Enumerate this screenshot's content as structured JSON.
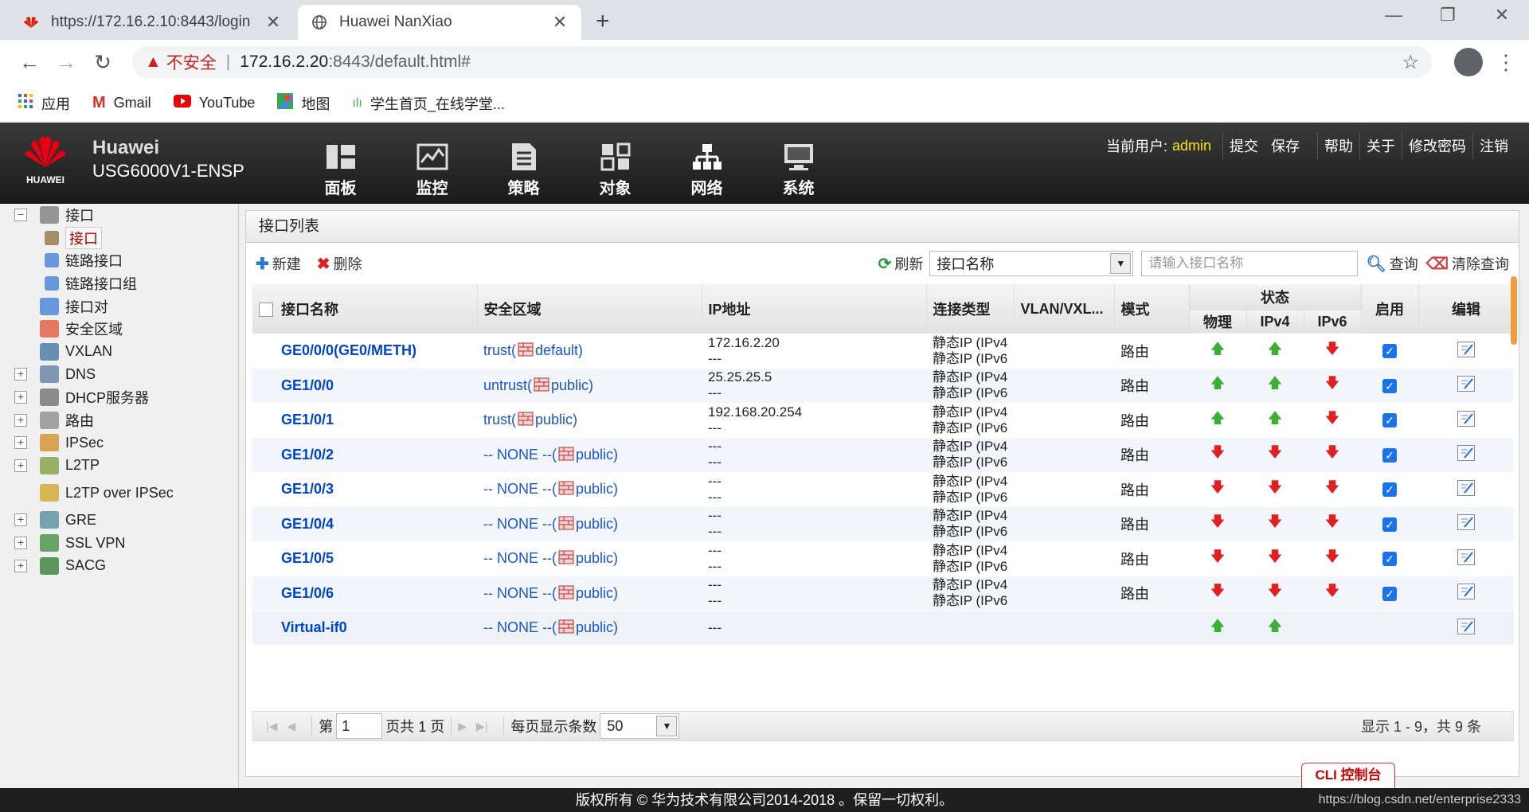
{
  "browser": {
    "tabs": [
      {
        "title": "https://172.16.2.10:8443/login",
        "active": false
      },
      {
        "title": "Huawei NanXiao",
        "active": true
      }
    ],
    "address": {
      "insecure_label": "不安全",
      "host": "172.16.2.20",
      "path": ":8443/default.html#"
    },
    "bookmarks": [
      {
        "label": "应用",
        "icon": "apps-grid-icon"
      },
      {
        "label": "Gmail",
        "icon": "gmail-icon"
      },
      {
        "label": "YouTube",
        "icon": "youtube-icon"
      },
      {
        "label": "地图",
        "icon": "maps-icon"
      },
      {
        "label": "学生首页_在线学堂...",
        "icon": "audio-wave-icon"
      }
    ]
  },
  "app": {
    "logo_text": "HUAWEI",
    "brand_line1": "Huawei",
    "brand_line2": "USG6000V1-ENSP",
    "nav": [
      {
        "label": "面板",
        "icon": "dashboard-icon"
      },
      {
        "label": "监控",
        "icon": "monitor-chart-icon"
      },
      {
        "label": "策略",
        "icon": "policy-doc-icon"
      },
      {
        "label": "对象",
        "icon": "object-icon"
      },
      {
        "label": "网络",
        "icon": "network-icon"
      },
      {
        "label": "系统",
        "icon": "system-icon"
      }
    ],
    "user_label": "当前用户:",
    "user_name": "admin",
    "links": [
      "提交",
      "保存",
      "帮助",
      "关于",
      "修改密码",
      "注销"
    ]
  },
  "sidebar": {
    "items": [
      {
        "label": "接口",
        "expand": "-",
        "indent": 0
      },
      {
        "label": "接口",
        "expand": "",
        "indent": 1,
        "selected": true
      },
      {
        "label": "链路接口",
        "expand": "",
        "indent": 1
      },
      {
        "label": "链路接口组",
        "expand": "",
        "indent": 1
      },
      {
        "label": "接口对",
        "expand": "",
        "indent": 0
      },
      {
        "label": "安全区域",
        "expand": "",
        "indent": 0
      },
      {
        "label": "VXLAN",
        "expand": "",
        "indent": 0
      },
      {
        "label": "DNS",
        "expand": "+",
        "indent": 0
      },
      {
        "label": "DHCP服务器",
        "expand": "+",
        "indent": 0
      },
      {
        "label": "路由",
        "expand": "+",
        "indent": 0
      },
      {
        "label": "IPSec",
        "expand": "+",
        "indent": 0
      },
      {
        "label": "L2TP",
        "expand": "+",
        "indent": 0
      },
      {
        "label": "L2TP over IPSec",
        "expand": "",
        "indent": 0
      },
      {
        "label": "GRE",
        "expand": "+",
        "indent": 0
      },
      {
        "label": "SSL VPN",
        "expand": "+",
        "indent": 0
      },
      {
        "label": "SACG",
        "expand": "+",
        "indent": 0
      }
    ]
  },
  "panel": {
    "title": "接口列表",
    "toolbar": {
      "new": "新建",
      "delete": "删除",
      "refresh": "刷新",
      "field_select": "接口名称",
      "search_placeholder": "请输入接口名称",
      "query": "查询",
      "clear_query": "清除查询"
    },
    "columns": {
      "name": "接口名称",
      "zone": "安全区域",
      "ip": "IP地址",
      "conn": "连接类型",
      "vlan": "VLAN/VXL...",
      "mode": "模式",
      "status": "状态",
      "phys": "物理",
      "ipv4": "IPv4",
      "ipv6": "IPv6",
      "enable": "启用",
      "edit": "编辑"
    },
    "rows": [
      {
        "name": "GE0/0/0(GE0/METH)",
        "zone_pre": "trust(",
        "zone_post": "default)",
        "ip1": "172.16.2.20",
        "ip2": "---",
        "c1": "静态IP (IPv4",
        "c2": "静态IP (IPv6",
        "mode": "路由",
        "phys": "up",
        "ipv4": "up",
        "ipv6": "down",
        "enabled": true
      },
      {
        "name": "GE1/0/0",
        "zone_pre": "untrust(",
        "zone_post": "public)",
        "ip1": "25.25.25.5",
        "ip2": "---",
        "c1": "静态IP (IPv4",
        "c2": "静态IP (IPv6",
        "mode": "路由",
        "phys": "up",
        "ipv4": "up",
        "ipv6": "down",
        "enabled": true
      },
      {
        "name": "GE1/0/1",
        "zone_pre": "trust(",
        "zone_post": "public)",
        "ip1": "192.168.20.254",
        "ip2": "---",
        "c1": "静态IP (IPv4",
        "c2": "静态IP (IPv6",
        "mode": "路由",
        "phys": "up",
        "ipv4": "up",
        "ipv6": "down",
        "enabled": true
      },
      {
        "name": "GE1/0/2",
        "zone_pre": "-- NONE --(",
        "zone_post": "public)",
        "ip1": "---",
        "ip2": "---",
        "c1": "静态IP (IPv4",
        "c2": "静态IP (IPv6",
        "mode": "路由",
        "phys": "down",
        "ipv4": "down",
        "ipv6": "down",
        "enabled": true
      },
      {
        "name": "GE1/0/3",
        "zone_pre": "-- NONE --(",
        "zone_post": "public)",
        "ip1": "---",
        "ip2": "---",
        "c1": "静态IP (IPv4",
        "c2": "静态IP (IPv6",
        "mode": "路由",
        "phys": "down",
        "ipv4": "down",
        "ipv6": "down",
        "enabled": true
      },
      {
        "name": "GE1/0/4",
        "zone_pre": "-- NONE --(",
        "zone_post": "public)",
        "ip1": "---",
        "ip2": "---",
        "c1": "静态IP (IPv4",
        "c2": "静态IP (IPv6",
        "mode": "路由",
        "phys": "down",
        "ipv4": "down",
        "ipv6": "down",
        "enabled": true
      },
      {
        "name": "GE1/0/5",
        "zone_pre": "-- NONE --(",
        "zone_post": "public)",
        "ip1": "---",
        "ip2": "---",
        "c1": "静态IP (IPv4",
        "c2": "静态IP (IPv6",
        "mode": "路由",
        "phys": "down",
        "ipv4": "down",
        "ipv6": "down",
        "enabled": true
      },
      {
        "name": "GE1/0/6",
        "zone_pre": "-- NONE --(",
        "zone_post": "public)",
        "ip1": "---",
        "ip2": "---",
        "c1": "静态IP (IPv4",
        "c2": "静态IP (IPv6",
        "mode": "路由",
        "phys": "down",
        "ipv4": "down",
        "ipv6": "down",
        "enabled": true
      },
      {
        "name": "Virtual-if0",
        "zone_pre": "-- NONE --(",
        "zone_post": "public)",
        "ip1": "---",
        "ip2": "",
        "c1": "",
        "c2": "",
        "mode": "",
        "phys": "up",
        "ipv4": "up",
        "ipv6": "",
        "enabled": null
      }
    ],
    "pager": {
      "page_label": "第",
      "page_value": "1",
      "total_label": "页共 1 页",
      "per_page_label": "每页显示条数",
      "per_page_value": "50",
      "info": "显示 1 - 9，共 9 条"
    }
  },
  "cli_button": "CLI 控制台",
  "footer": {
    "text": "版权所有 © 华为技术有限公司2014-2018 。保留一切权利。",
    "watermark": "https://blog.csdn.net/enterprise2333"
  },
  "colors": {
    "up_arrow": "#3cb034",
    "down_arrow": "#e02020",
    "link_blue": "#1a55cc",
    "header_bg": "#2a2a2a"
  }
}
